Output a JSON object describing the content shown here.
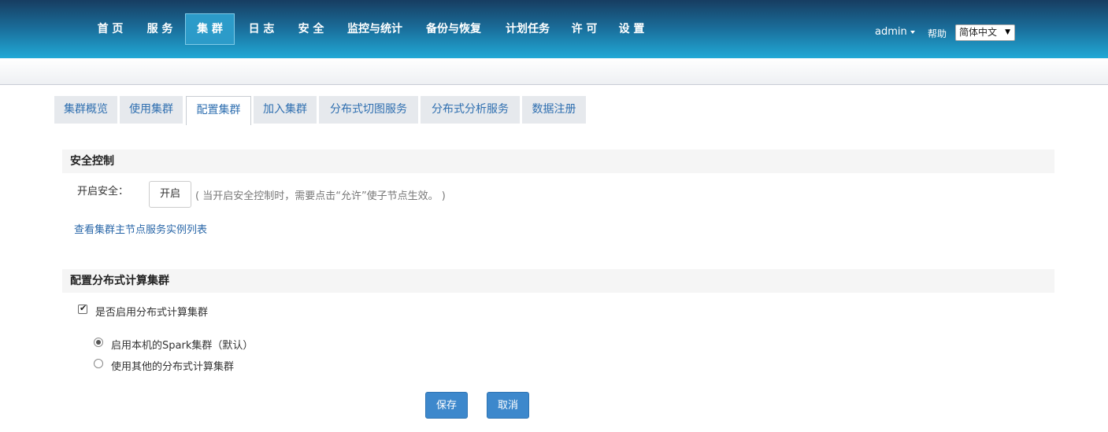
{
  "nav": {
    "items": [
      {
        "label": "首 页"
      },
      {
        "label": "服 务"
      },
      {
        "label": "集 群"
      },
      {
        "label": "日 志"
      },
      {
        "label": "安 全"
      },
      {
        "label": "监控与统计"
      },
      {
        "label": "备份与恢复"
      },
      {
        "label": "计划任务"
      },
      {
        "label": "许 可"
      },
      {
        "label": "设 置"
      }
    ],
    "active": "集 群",
    "user": "admin",
    "help": "帮助",
    "language": "简体中文"
  },
  "tabs": {
    "items": [
      {
        "label": "集群概览"
      },
      {
        "label": "使用集群"
      },
      {
        "label": "配置集群"
      },
      {
        "label": "加入集群"
      },
      {
        "label": "分布式切图服务"
      },
      {
        "label": "分布式分析服务"
      },
      {
        "label": "数据注册"
      }
    ],
    "active": "配置集群"
  },
  "security": {
    "title": "安全控制",
    "enable_label": "开启安全：",
    "enable_button": "开启",
    "hint": "( 当开启安全控制时，需要点击“允许”使子节点生效。 )",
    "link": "查看集群主节点服务实例列表"
  },
  "distributed": {
    "title": "配置分布式计算集群",
    "enable_checkbox_label": "是否启用分布式计算集群",
    "enable_checked": true,
    "options": [
      {
        "label": "启用本机的Spark集群（默认）",
        "checked": true
      },
      {
        "label": "使用其他的分布式计算集群",
        "checked": false
      }
    ]
  },
  "actions": {
    "save": "保存",
    "cancel": "取消"
  },
  "colors": {
    "nav_gradient_top": "#173d61",
    "nav_gradient_bottom": "#21a9d6",
    "link": "#2a67a8",
    "primary_button": "#3d88cc"
  }
}
